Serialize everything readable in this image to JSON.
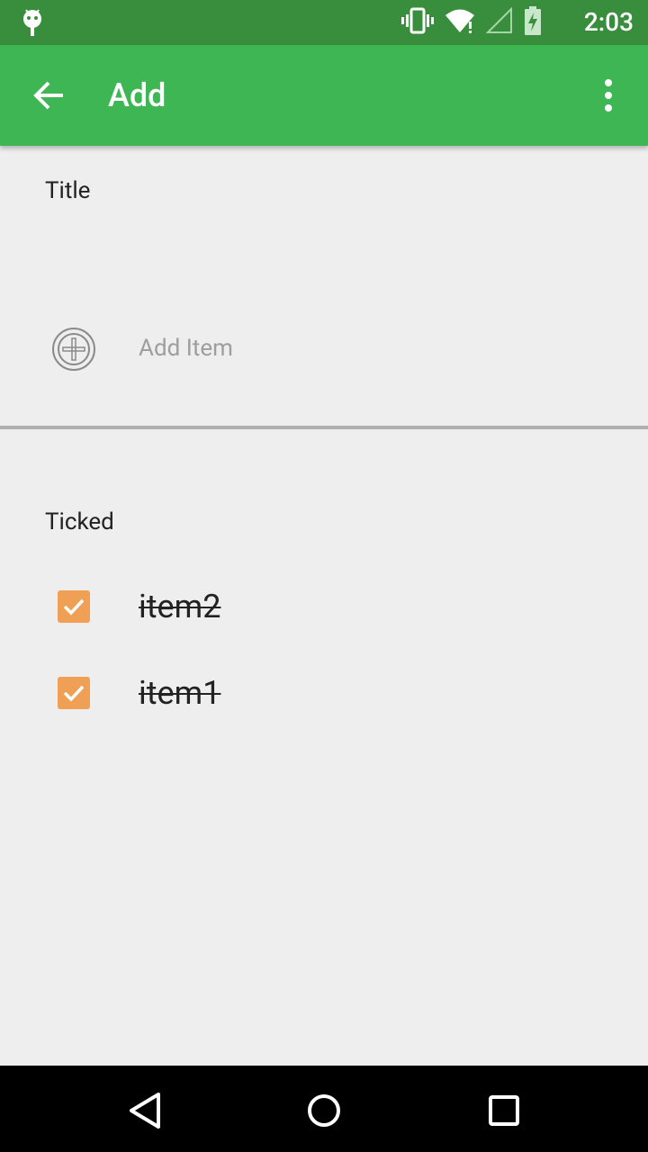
{
  "status_bar": {
    "time": "2:03",
    "icons": [
      "android-debug-icon",
      "vibrate-icon",
      "wifi-icon",
      "signal-icon",
      "battery-charging-icon"
    ]
  },
  "toolbar": {
    "title": "Add",
    "back_icon": "back-arrow-icon",
    "overflow_icon": "more-vert-icon",
    "background_color": "#3db653"
  },
  "note": {
    "title_label": "Title",
    "add_item_label": "Add Item"
  },
  "ticked": {
    "label": "Ticked",
    "items": [
      {
        "label": "item2",
        "checked": true
      },
      {
        "label": "item1",
        "checked": true
      }
    ],
    "checkbox_color": "#f0a055"
  },
  "nav_bar": {
    "buttons": [
      "back-triangle-icon",
      "home-circle-icon",
      "recents-square-icon"
    ]
  }
}
